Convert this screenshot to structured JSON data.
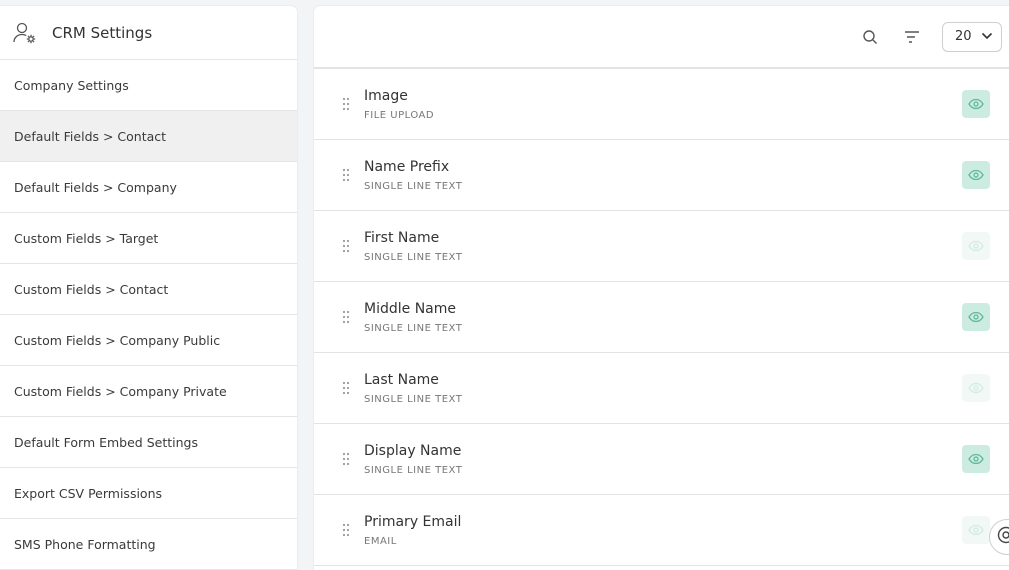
{
  "sidebar": {
    "title": "CRM Settings",
    "header_icon": "user-gear-icon",
    "items": [
      {
        "label": "Company Settings",
        "active": false
      },
      {
        "label": "Default Fields > Contact",
        "active": true
      },
      {
        "label": "Default Fields > Company",
        "active": false
      },
      {
        "label": "Custom Fields > Target",
        "active": false
      },
      {
        "label": "Custom Fields > Contact",
        "active": false
      },
      {
        "label": "Custom Fields > Company Public",
        "active": false
      },
      {
        "label": "Custom Fields > Company Private",
        "active": false
      },
      {
        "label": "Default Form Embed Settings",
        "active": false
      },
      {
        "label": "Export CSV Permissions",
        "active": false
      },
      {
        "label": "SMS Phone Formatting",
        "active": false
      }
    ]
  },
  "toolbar": {
    "search_icon": "search-icon",
    "sort_icon": "sort-icon",
    "page_size": "20"
  },
  "fields": [
    {
      "label": "Image",
      "type": "FILE UPLOAD",
      "visible": true
    },
    {
      "label": "Name Prefix",
      "type": "SINGLE LINE TEXT",
      "visible": true
    },
    {
      "label": "First Name",
      "type": "SINGLE LINE TEXT",
      "visible": false
    },
    {
      "label": "Middle Name",
      "type": "SINGLE LINE TEXT",
      "visible": true
    },
    {
      "label": "Last Name",
      "type": "SINGLE LINE TEXT",
      "visible": false
    },
    {
      "label": "Display Name",
      "type": "SINGLE LINE TEXT",
      "visible": true
    },
    {
      "label": "Primary Email",
      "type": "EMAIL",
      "visible": false
    }
  ],
  "colors": {
    "eye_on_bg": "#cdece1",
    "eye_off_bg": "#f1f8f5",
    "eye_on_stroke": "#5fb89a",
    "eye_off_stroke": "#d3ebe2"
  }
}
